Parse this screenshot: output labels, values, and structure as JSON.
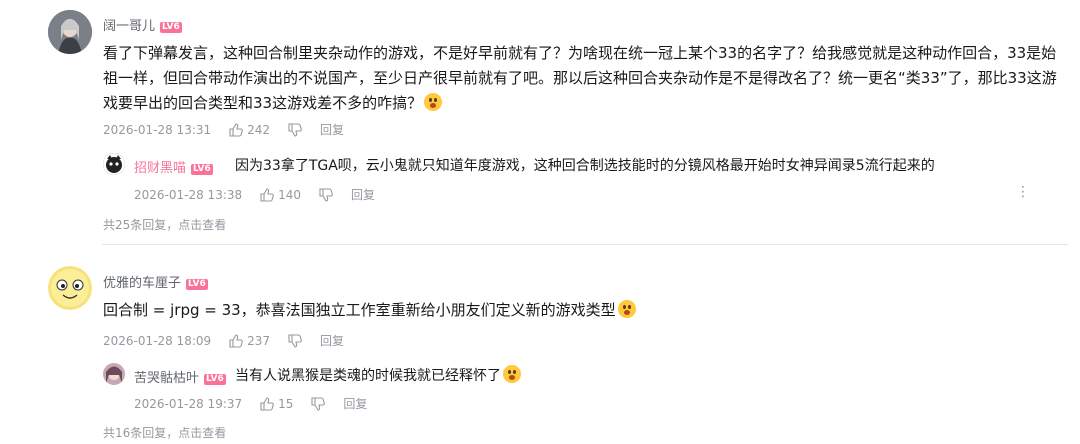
{
  "comments": [
    {
      "user": "阔一哥儿",
      "level": "LV6",
      "text": "看了下弹幕发言，这种回合制里夹杂动作的游戏，不是好早前就有了？为啥现在统一冠上某个33的名字了？给我感觉就是这种动作回合，33是始祖一样，但回合带动作演出的不说国产，至少日产很早前就有了吧。那以后这种回合夹杂动作是不是得改名了？统一更名“类33”了，那比33这游戏要早出的回合类型和33这游戏差不多的咋搞？",
      "time": "2026-01-28 13:31",
      "likes": "242",
      "reply_label": "回复",
      "replies": [
        {
          "user": "招财黑喵",
          "level": "LV6",
          "text": "因为33拿了TGA呗，云小鬼就只知道年度游戏，这种回合制选技能时的分镜风格最开始时女神异闻录5流行起来的",
          "time": "2026-01-28 13:38",
          "likes": "140",
          "reply_label": "回复"
        }
      ],
      "more_replies": "共25条回复，点击查看"
    },
    {
      "user": "优雅的车厘子",
      "level": "LV6",
      "text": "回合制 = jrpg = 33，恭喜法国独立工作室重新给小朋友们定义新的游戏类型",
      "time": "2026-01-28 18:09",
      "likes": "237",
      "reply_label": "回复",
      "replies": [
        {
          "user": "苦哭骷枯叶",
          "level": "LV6",
          "text": "当有人说黑猴是类魂的时候我就已经释怀了",
          "time": "2026-01-28 19:37",
          "likes": "15",
          "reply_label": "回复"
        }
      ],
      "more_replies": "共16条回复，点击查看"
    }
  ],
  "icons": {
    "like": "thumbs-up-icon",
    "dislike": "thumbs-down-icon",
    "more": "more-dots-icon"
  },
  "colors": {
    "accent": "#fb7299",
    "muted": "#9499a0",
    "text": "#18191c"
  }
}
